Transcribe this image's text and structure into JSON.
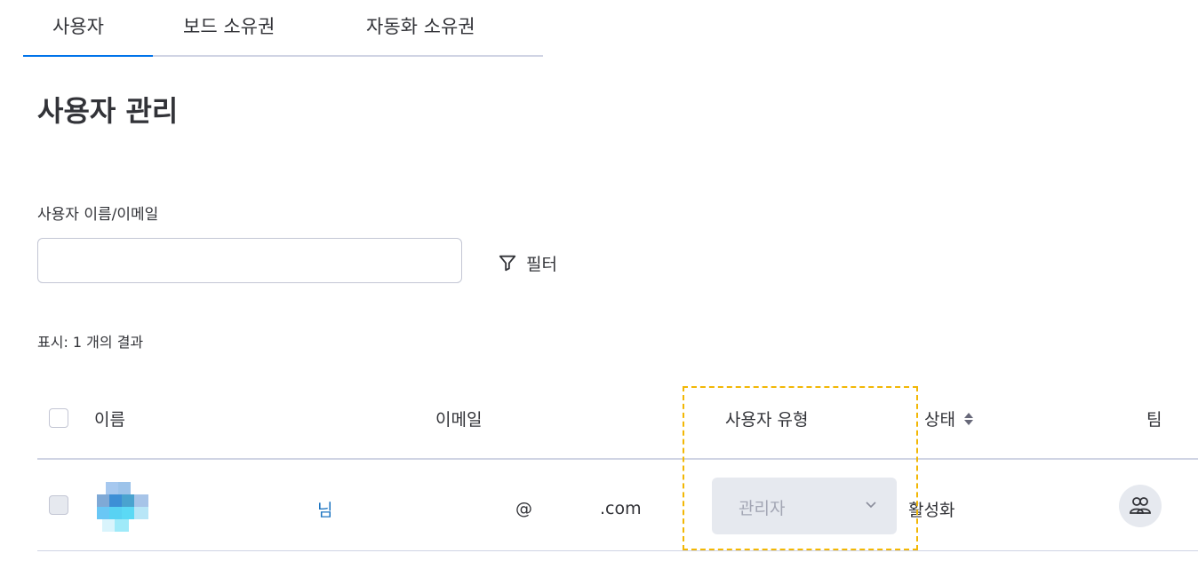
{
  "tabs": [
    {
      "label": "사용자",
      "active": true
    },
    {
      "label": "보드 소유권",
      "active": false
    },
    {
      "label": "자동화 소유권",
      "active": false
    }
  ],
  "page_title": "사용자 관리",
  "search": {
    "label": "사용자 이름/이메일",
    "value": "",
    "placeholder": ""
  },
  "filter": {
    "label": "필터",
    "icon": "filter-icon"
  },
  "results_text": "표시: 1 개의 결과",
  "table": {
    "columns": {
      "name": "이름",
      "email": "이메일",
      "user_type": "사용자 유형",
      "status": "상태",
      "teams": "팀"
    },
    "rows": [
      {
        "name": "님",
        "email_at": "@",
        "email_domain": ".com",
        "user_type": "관리자",
        "status": "활성화",
        "teams_icon": "team-icon"
      }
    ]
  },
  "colors": {
    "accent": "#0073ea",
    "link": "#1f76c2",
    "highlight": "#f2b705",
    "select_bg": "#e6e9ef"
  }
}
